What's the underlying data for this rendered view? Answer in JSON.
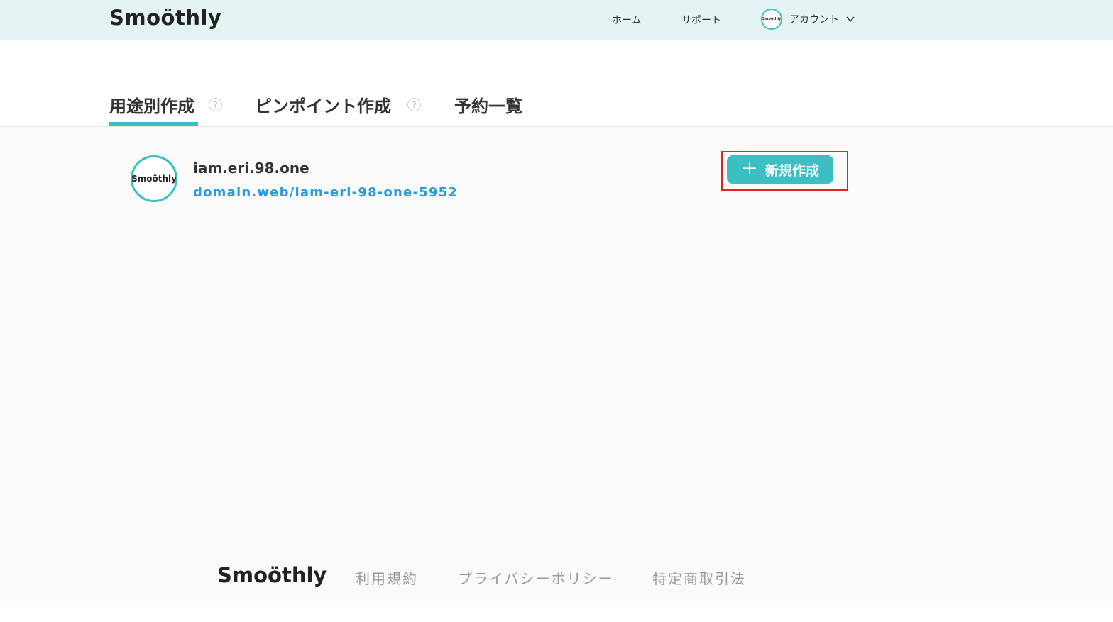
{
  "header": {
    "logo": "Smoöthly",
    "nav": {
      "home": "ホーム",
      "support": "サポート",
      "account": "アカウント",
      "avatar_text": "Smoöthly"
    }
  },
  "tabs": [
    {
      "label": "用途別作成",
      "help": "?",
      "active": true
    },
    {
      "label": "ピンポイント作成",
      "help": "?",
      "active": false
    },
    {
      "label": "予約一覧",
      "active": false
    }
  ],
  "account_card": {
    "avatar_text": "Smoöthly",
    "name": "iam.eri.98.one",
    "url": "domain.web/iam-eri-98-one-5952"
  },
  "actions": {
    "new_button": "新規作成",
    "new_icon": "plus-icon"
  },
  "footer": {
    "logo": "Smoöthly",
    "links": [
      "利用規約",
      "プライバシーポリシー",
      "特定商取引法"
    ]
  },
  "colors": {
    "accent": "#3bbfc2",
    "header_bg": "#e3f4f3",
    "link": "#2a9ae0",
    "highlight": "#e02424"
  }
}
